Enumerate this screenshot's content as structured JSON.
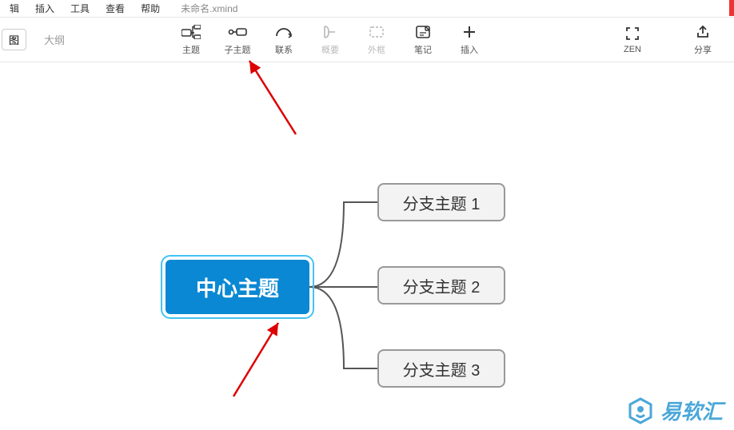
{
  "menubar": {
    "items": [
      "辑",
      "插入",
      "工具",
      "查看",
      "帮助"
    ],
    "title": "未命名.xmind"
  },
  "viewtabs": {
    "map": "图",
    "outline": "大纲"
  },
  "toolbar": {
    "topic": "主题",
    "subtopic": "子主题",
    "relation": "联系",
    "summary": "概要",
    "boundary": "外框",
    "notes": "笔记",
    "insert": "插入",
    "zen": "ZEN",
    "share": "分享"
  },
  "mindmap": {
    "central": "中心主题",
    "branches": [
      "分支主题 1",
      "分支主题 2",
      "分支主题 3"
    ]
  },
  "watermark": "易软汇"
}
